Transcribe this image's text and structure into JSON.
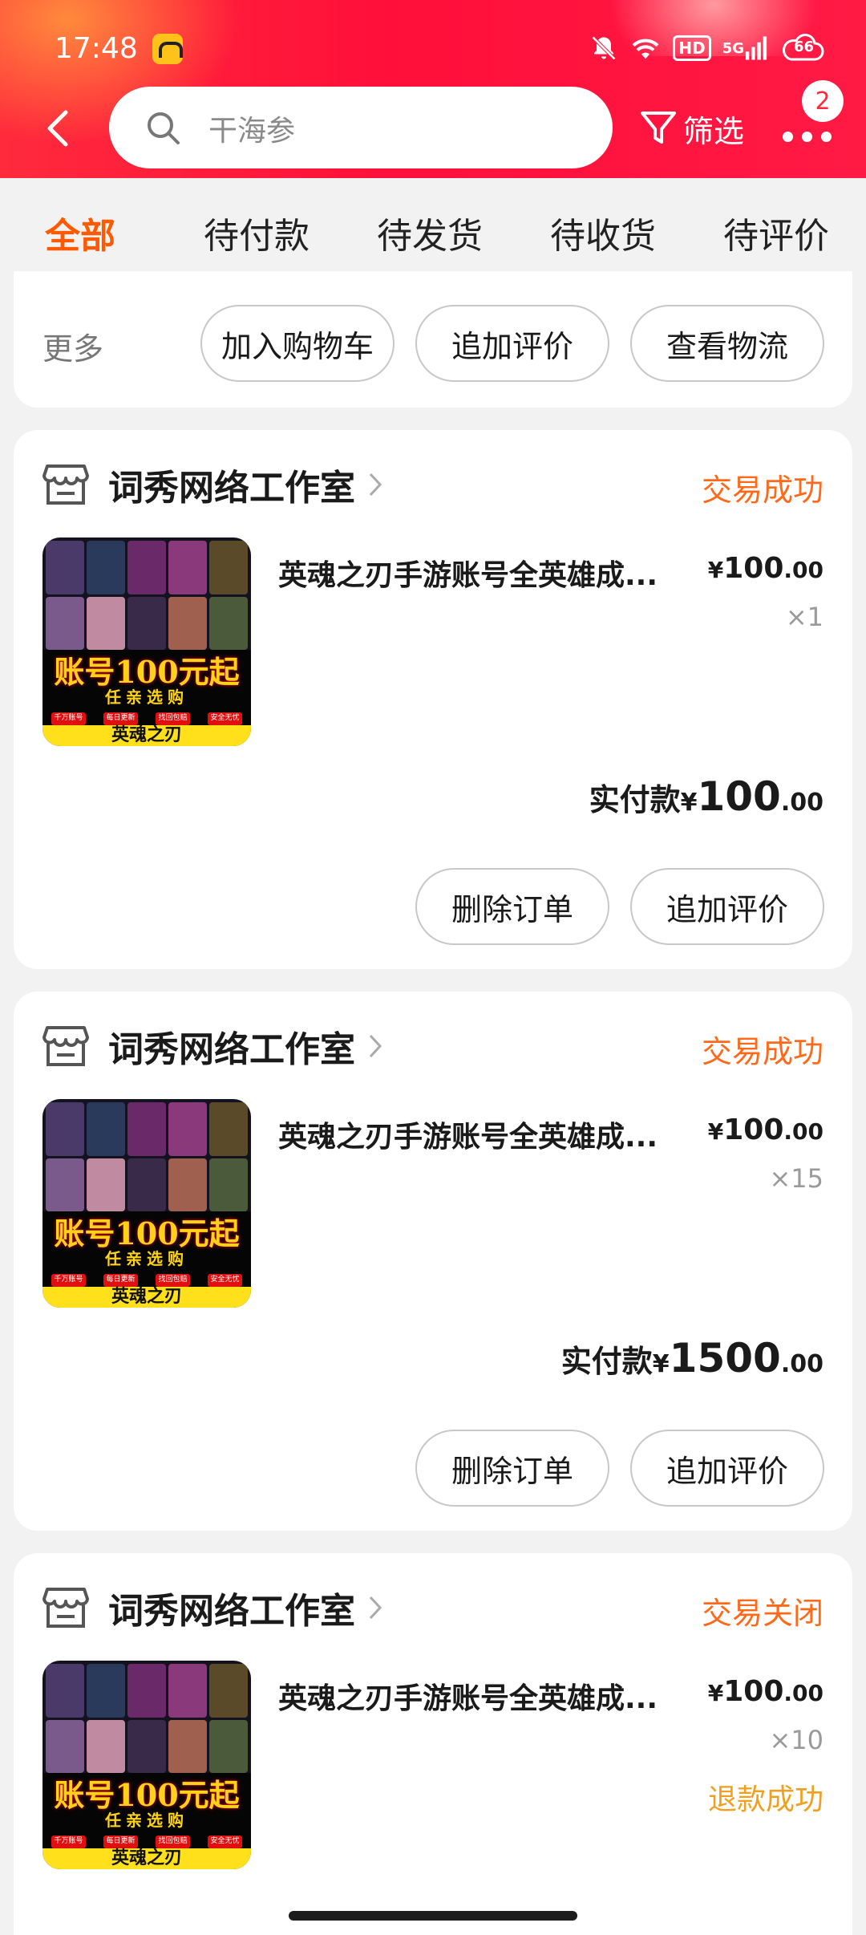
{
  "status_bar": {
    "time": "17:48",
    "hd_label": "HD",
    "signal_label": "5G",
    "cloud_label": "66"
  },
  "header": {
    "search_placeholder": "干海参",
    "filter_label": "筛选",
    "badge_count": "2",
    "accent_color": "#ff1a3c"
  },
  "tabs": [
    {
      "label": "全部",
      "active": true
    },
    {
      "label": "待付款"
    },
    {
      "label": "待发货"
    },
    {
      "label": "待收货"
    },
    {
      "label": "待评价"
    }
  ],
  "top_partial": {
    "more_label": "更多",
    "buttons": [
      "加入购物车",
      "追加评价",
      "查看物流"
    ]
  },
  "orders": [
    {
      "store": "词秀网络工作室",
      "status": "交易成功",
      "title": "英魂之刃手游账号全英雄成...",
      "price_cur": "¥",
      "price_int": "100",
      "price_dec": ".00",
      "qty": "×1",
      "paid_label": "实付款",
      "paid_cur": "¥",
      "paid_int": "100",
      "paid_dec": ".00",
      "actions": [
        "删除订单",
        "追加评价"
      ]
    },
    {
      "store": "词秀网络工作室",
      "status": "交易成功",
      "title": "英魂之刃手游账号全英雄成...",
      "price_cur": "¥",
      "price_int": "100",
      "price_dec": ".00",
      "qty": "×15",
      "paid_label": "实付款",
      "paid_cur": "¥",
      "paid_int": "1500",
      "paid_dec": ".00",
      "actions": [
        "删除订单",
        "追加评价"
      ]
    },
    {
      "store": "词秀网络工作室",
      "status": "交易关闭",
      "title": "英魂之刃手游账号全英雄成...",
      "price_cur": "¥",
      "price_int": "100",
      "price_dec": ".00",
      "qty": "×10",
      "refund": "退款成功"
    }
  ],
  "thumbnail": {
    "banner_main": "账号100元起",
    "banner_sub": "任亲选购",
    "tags": [
      "千万账号",
      "每日更新",
      "找回包赔",
      "安全无忧"
    ],
    "footer": "英魂之刃"
  }
}
